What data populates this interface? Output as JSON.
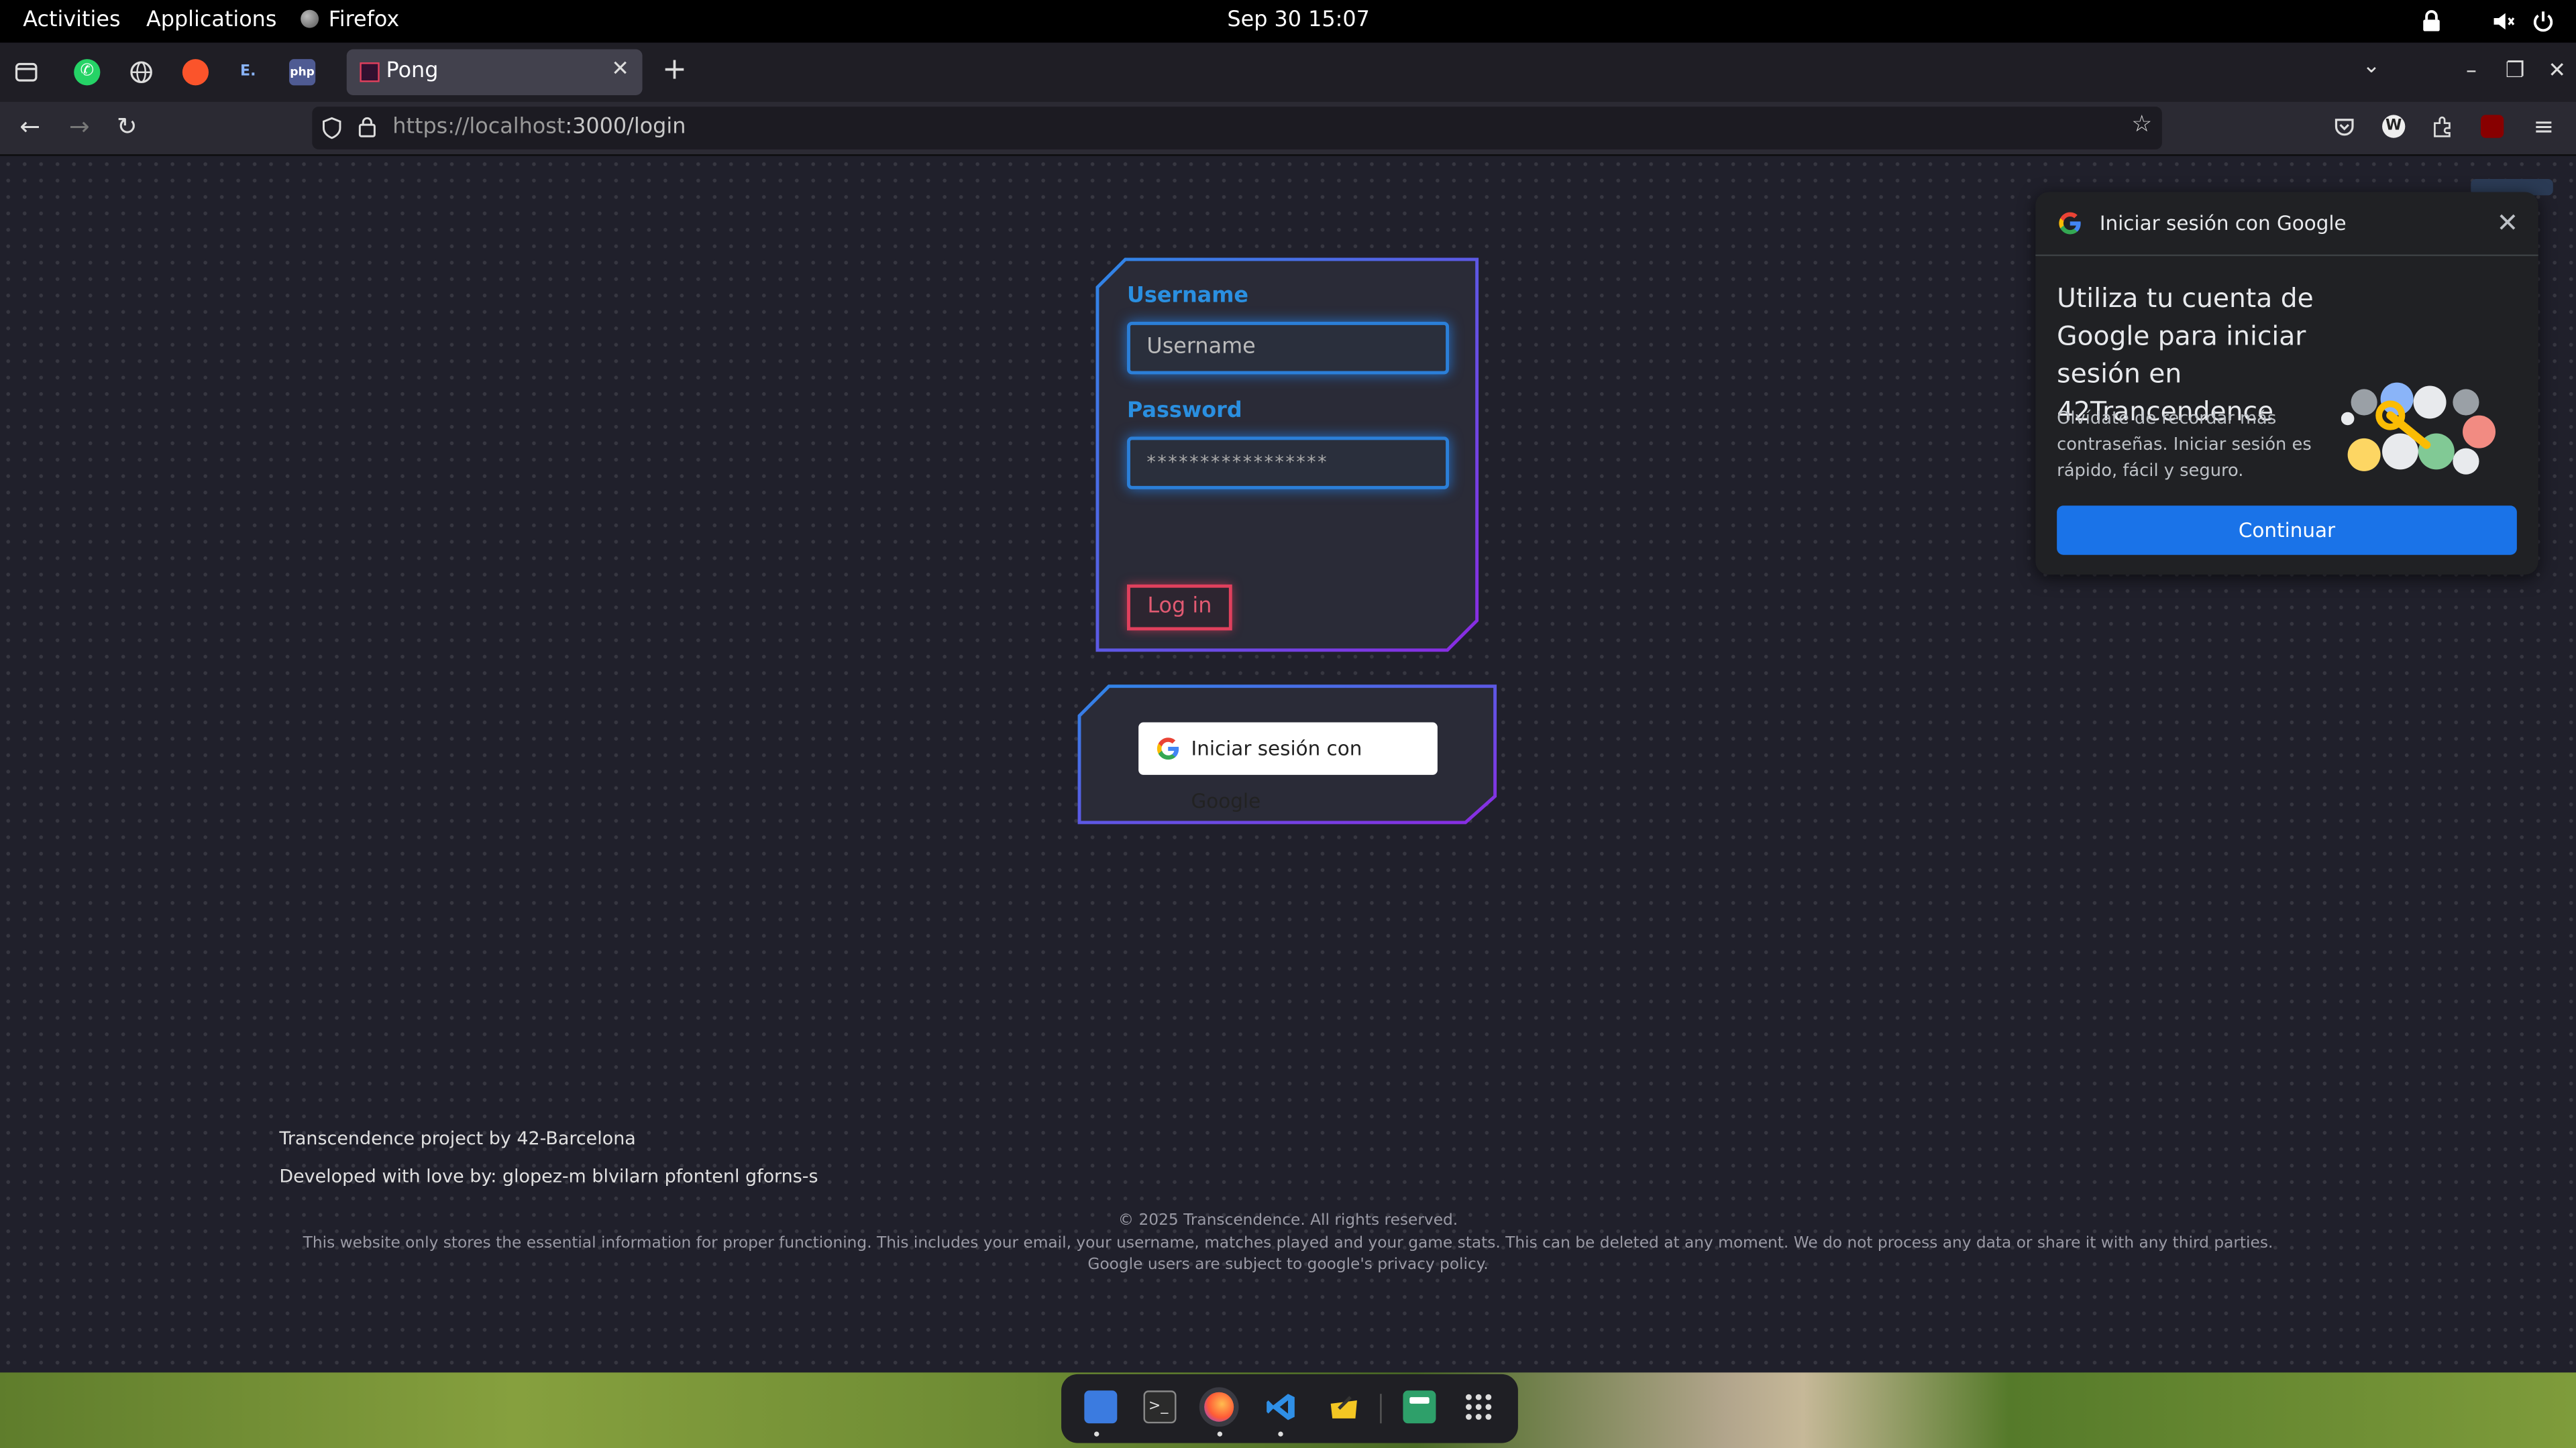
{
  "topbar": {
    "activities": "Activities",
    "applications": "Applications",
    "app_name": "Firefox",
    "clock": "Sep 30  15:07"
  },
  "browser": {
    "tab_title": "Pong",
    "url_host": "https://localhost",
    "url_path": ":3000/login",
    "pinned_tabs": [
      "whatsapp-icon",
      "globe-icon",
      "brave-icon",
      "element-icon",
      "php-icon"
    ]
  },
  "login_form": {
    "username_label": "Username",
    "username_placeholder": "Username",
    "password_label": "Password",
    "password_value": "*****************",
    "login_button": "Log in"
  },
  "google_signin": {
    "button_label": "Iniciar sesión con Google"
  },
  "footer": {
    "project_line": "Transcendence project by 42-Barcelona",
    "developers_line": "Developed with love by: glopez-m blvilarn pfontenl gforns-s",
    "copyright": "© 2025 Transcendence. All rights reserved.",
    "privacy_notice": "This website only stores the essential information for proper functioning. This includes your email, your username, matches played and your game stats. This can be deleted at any moment. We do not process any data or share it with any third parties. Google users are subject to google's privacy policy."
  },
  "google_popup": {
    "header": "Iniciar sesión con Google",
    "heading": "Utiliza tu cuenta de Google para iniciar sesión en 42Trancendence",
    "body": "Olvídate de recordar más contraseñas. Iniciar sesión es rápido, fácil y seguro.",
    "continue_button": "Continuar"
  },
  "dock": {
    "apps": [
      "files-icon",
      "terminal-icon",
      "firefox-icon",
      "vscode-icon",
      "notes-icon",
      "software-store-icon",
      "app-grid-icon"
    ]
  },
  "colors": {
    "accent_blue": "#2a8fe0",
    "login_red": "#e0405d",
    "google_blue": "#1a73e8",
    "page_bg": "#20202b"
  }
}
